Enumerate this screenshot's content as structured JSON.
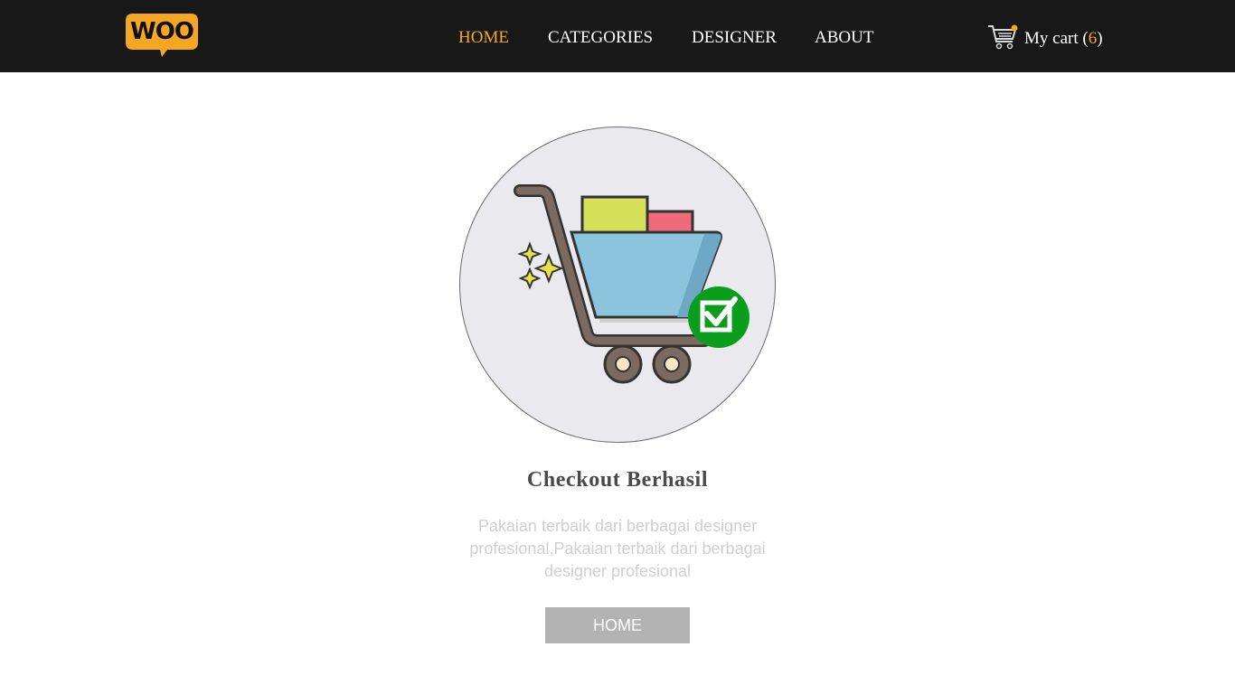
{
  "header": {
    "logo_text": "WOO",
    "nav": [
      {
        "label": "HOME",
        "active": true
      },
      {
        "label": "CATEGORIES",
        "active": false
      },
      {
        "label": "DESIGNER",
        "active": false
      },
      {
        "label": "ABOUT",
        "active": false
      }
    ],
    "cart": {
      "label_prefix": "My cart (",
      "count": "6",
      "label_suffix": ")",
      "icon": "shopping-cart-icon"
    }
  },
  "main": {
    "illustration": "shopping-cart-checkout-illustration",
    "title": "Checkout Berhasil",
    "description": "Pakaian terbaik dari berbagai designer profesional,Pakaian terbaik dari berbagai designer profesional",
    "button_label": "HOME"
  },
  "colors": {
    "header_bg": "#181818",
    "accent": "#f5a623",
    "success": "#0a9e1c",
    "button_bg": "#b3b3b3"
  }
}
